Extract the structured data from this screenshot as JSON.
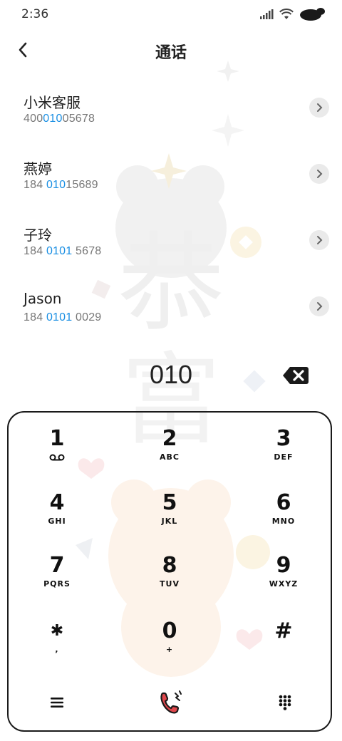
{
  "status_bar": {
    "time": "2:36"
  },
  "header": {
    "title": "通话"
  },
  "contacts": [
    {
      "name": "小米客服",
      "number_before": "400",
      "number_match": "010",
      "number_after": "05678"
    },
    {
      "name": "燕婷",
      "number_before": "184 ",
      "number_match": "010",
      "number_after": "15689"
    },
    {
      "name": "子玲",
      "number_before": "184 ",
      "number_match": "0101",
      "number_after": " 5678"
    },
    {
      "name": "Jason",
      "number_before": "184 ",
      "number_match": "0101",
      "number_after": " 0029"
    }
  ],
  "dialer": {
    "value": "010"
  },
  "keypad": {
    "keys": [
      {
        "digit": "1",
        "letters": ""
      },
      {
        "digit": "2",
        "letters": "ABC"
      },
      {
        "digit": "3",
        "letters": "DEF"
      },
      {
        "digit": "4",
        "letters": "GHI"
      },
      {
        "digit": "5",
        "letters": "JKL"
      },
      {
        "digit": "6",
        "letters": "MNO"
      },
      {
        "digit": "7",
        "letters": "PQRS"
      },
      {
        "digit": "8",
        "letters": "TUV"
      },
      {
        "digit": "9",
        "letters": "WXYZ"
      },
      {
        "digit": "✱",
        "letters": ","
      },
      {
        "digit": "0",
        "letters": "+"
      },
      {
        "digit": "#",
        "letters": ""
      }
    ],
    "bottom": {
      "menu_icon": "menu-icon",
      "call_icon": "phone-call-icon",
      "keypad_icon": "dialpad-icon"
    }
  },
  "colors": {
    "highlight": "#1a8fe3",
    "call": "#e0474c"
  }
}
